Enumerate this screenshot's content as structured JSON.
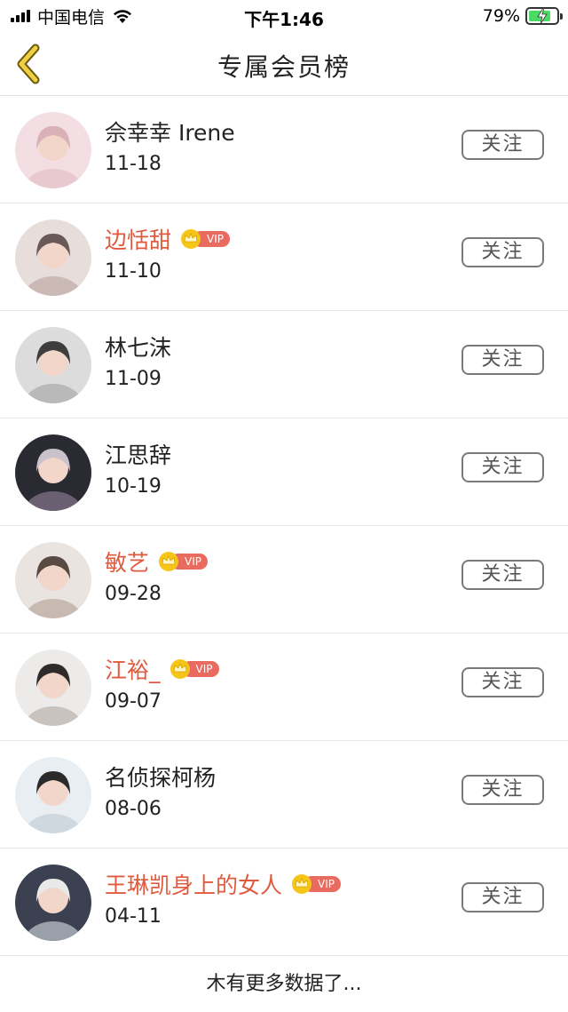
{
  "status_bar": {
    "carrier": "中国电信",
    "time": "下午1:46",
    "battery": "79%",
    "battery_level": 0.79
  },
  "header": {
    "title": "专属会员榜",
    "back_icon": "chevron-left-icon"
  },
  "list": [
    {
      "name": "佘幸幸 Irene",
      "date": "11-18",
      "vip": false,
      "follow_label": "关注"
    },
    {
      "name": "边恬甜",
      "date": "11-10",
      "vip": true,
      "vip_label": "VIP",
      "follow_label": "关注"
    },
    {
      "name": "林七沫",
      "date": "11-09",
      "vip": false,
      "follow_label": "关注"
    },
    {
      "name": "江思辞",
      "date": "10-19",
      "vip": false,
      "follow_label": "关注"
    },
    {
      "name": "敏艺",
      "date": "09-28",
      "vip": true,
      "vip_label": "VIP",
      "follow_label": "关注"
    },
    {
      "name": "江裕_",
      "date": "09-07",
      "vip": true,
      "vip_label": "VIP",
      "follow_label": "关注"
    },
    {
      "name": "名侦探柯杨",
      "date": "08-06",
      "vip": false,
      "follow_label": "关注"
    },
    {
      "name": "王琳凯身上的女人",
      "date": "04-11",
      "vip": true,
      "vip_label": "VIP",
      "follow_label": "关注"
    }
  ],
  "footer": "木有更多数据了...",
  "colors": {
    "vip_name": "#e05a3e",
    "vip_badge": "#e96b5f",
    "crown": "#f5c518",
    "back_icon": "#f0d040",
    "battery_fill": "#4cd964"
  }
}
